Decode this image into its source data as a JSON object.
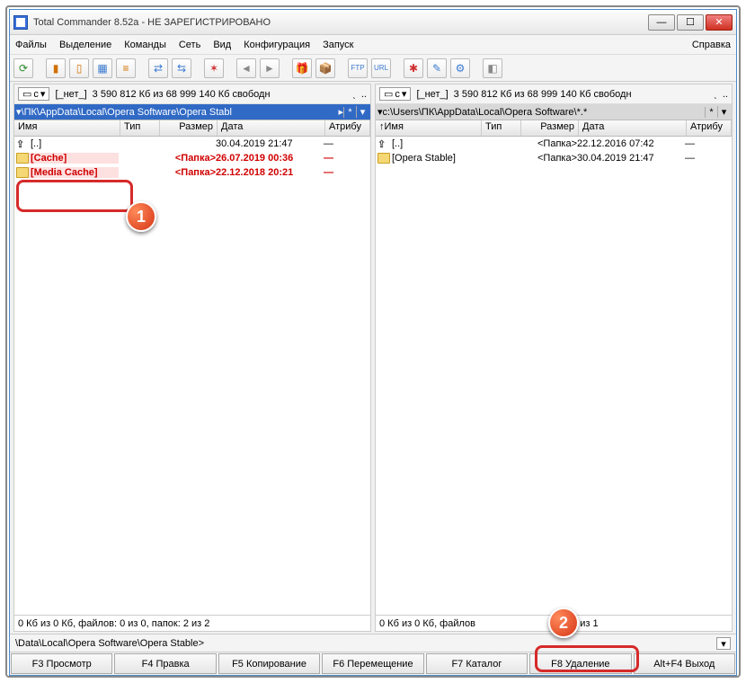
{
  "window": {
    "title": "Total Commander 8.52a - НЕ ЗАРЕГИСТРИРОВАНО"
  },
  "menu": {
    "files": "Файлы",
    "selection": "Выделение",
    "commands": "Команды",
    "net": "Сеть",
    "view": "Вид",
    "config": "Конфигурация",
    "start": "Запуск",
    "help": "Справка"
  },
  "drive": {
    "letter": "c",
    "none": "[_нет_]",
    "free": "3 590 812 Кб из 68 999 140 Кб свободн"
  },
  "columns": {
    "name": "Имя",
    "type": "Тип",
    "size": "Размер",
    "date": "Дата",
    "attr": "Атрибу"
  },
  "left": {
    "path": "\\ПК\\AppData\\Local\\Opera Software\\Opera Stabl",
    "star": "*",
    "rows": [
      {
        "name": "[..]",
        "size": "",
        "date": "30.04.2019 21:47",
        "attr": "—",
        "up": true
      },
      {
        "name": "[Cache]",
        "size": "<Папка>",
        "date": "26.07.2019 00:36",
        "attr": "—",
        "sel": true
      },
      {
        "name": "[Media Cache]",
        "size": "<Папка>",
        "date": "22.12.2018 20:21",
        "attr": "—",
        "sel": true
      }
    ],
    "status": "0 Кб из 0 Кб, файлов: 0 из 0, папок: 2 из 2"
  },
  "right": {
    "path": "c:\\Users\\ПК\\AppData\\Local\\Opera Software\\*.*",
    "rows": [
      {
        "name": "[..]",
        "size": "<Папка>",
        "date": "22.12.2016 07:42",
        "attr": "—",
        "up": true
      },
      {
        "name": "[Opera Stable]",
        "size": "<Папка>",
        "date": "30.04.2019 21:47",
        "attr": "—"
      }
    ],
    "status_a": "0 Кб из 0 Кб, файлов",
    "status_b": "ок: 0 из 1"
  },
  "cmdline": {
    "prompt": "\\Data\\Local\\Opera Software\\Opera Stable>"
  },
  "fkeys": {
    "f3": "F3 Просмотр",
    "f4": "F4 Правка",
    "f5": "F5 Копирование",
    "f6": "F6 Перемещение",
    "f7": "F7 Каталог",
    "f8": "F8 Удаление",
    "altf4": "Alt+F4 Выход"
  },
  "callouts": {
    "one": "1",
    "two": "2"
  }
}
